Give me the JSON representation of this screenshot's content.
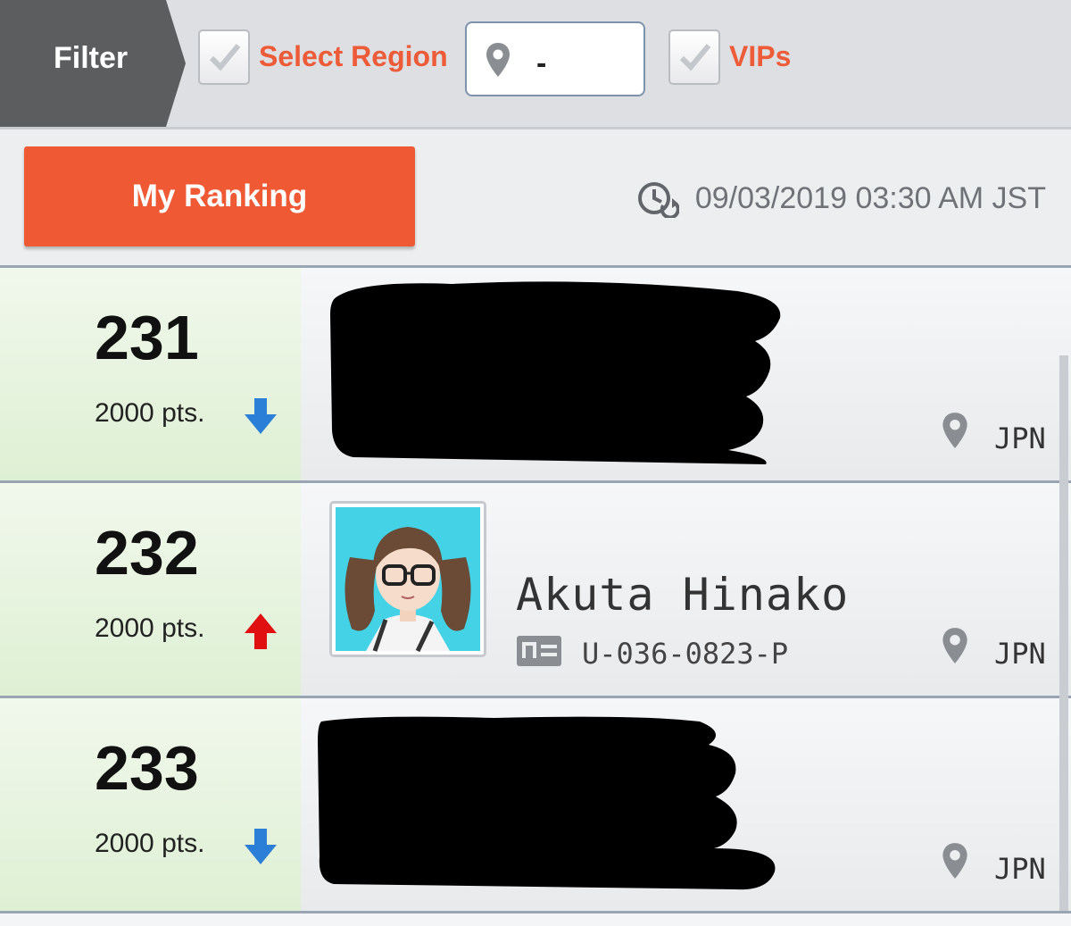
{
  "filter": {
    "label": "Filter",
    "select_region": {
      "label": "Select Region",
      "checked": true
    },
    "region_input": {
      "value": "-",
      "icon": "location-pin-icon"
    },
    "vips": {
      "label": "VIPs",
      "checked": true
    }
  },
  "header": {
    "my_ranking_label": "My Ranking",
    "updated": "09/03/2019 03:30 AM JST",
    "updated_icon": "clock-refresh-icon"
  },
  "colors": {
    "accent": "#ee5b38",
    "trend_up": "#e01010",
    "trend_down": "#2c7fd6",
    "rank_cell": "#e3f2da"
  },
  "rankings": [
    {
      "rank": "231",
      "points": "2000 pts.",
      "trend": "down",
      "name": "",
      "id": "",
      "region": "JPN",
      "redacted": true
    },
    {
      "rank": "232",
      "points": "2000 pts.",
      "trend": "up",
      "name": "Akuta Hinako",
      "id": "U-036-0823-P",
      "region": "JPN",
      "redacted": false
    },
    {
      "rank": "233",
      "points": "2000 pts.",
      "trend": "down",
      "name": "",
      "id": "",
      "region": "JPN",
      "redacted": true
    }
  ]
}
